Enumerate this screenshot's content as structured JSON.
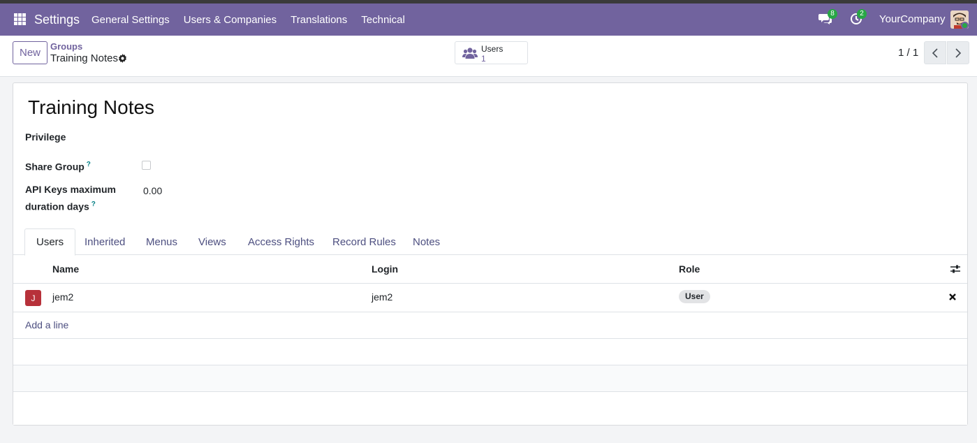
{
  "navbar": {
    "brand": "Settings",
    "menu": [
      "General Settings",
      "Users & Companies",
      "Translations",
      "Technical"
    ],
    "messages_count": "8",
    "activities_count": "2",
    "company": "YourCompany"
  },
  "control": {
    "new_label": "New",
    "breadcrumb_parent": "Groups",
    "breadcrumb_current": "Training Notes",
    "smart_button_label": "Users",
    "smart_button_value": "1",
    "pager": "1 / 1"
  },
  "form": {
    "title": "Training Notes",
    "privilege_label": "Privilege",
    "share_group_label": "Share Group",
    "share_group_checked": false,
    "api_keys_label_line1": "API Keys maximum",
    "api_keys_label_line2": "duration days",
    "api_keys_value": "0.00",
    "help_marker": "?"
  },
  "tabs": [
    "Users",
    "Inherited",
    "Menus",
    "Views",
    "Access Rights",
    "Record Rules",
    "Notes"
  ],
  "active_tab": "Users",
  "table": {
    "columns": [
      "Name",
      "Login",
      "Role"
    ],
    "rows": [
      {
        "avatar_letter": "J",
        "name": "jem2",
        "login": "jem2",
        "role": "User"
      }
    ],
    "add_line": "Add a line"
  },
  "colors": {
    "brand": "#71639e",
    "badge": "#28a745",
    "avatar_j": "#b7313a",
    "link": "#4d4f80"
  }
}
